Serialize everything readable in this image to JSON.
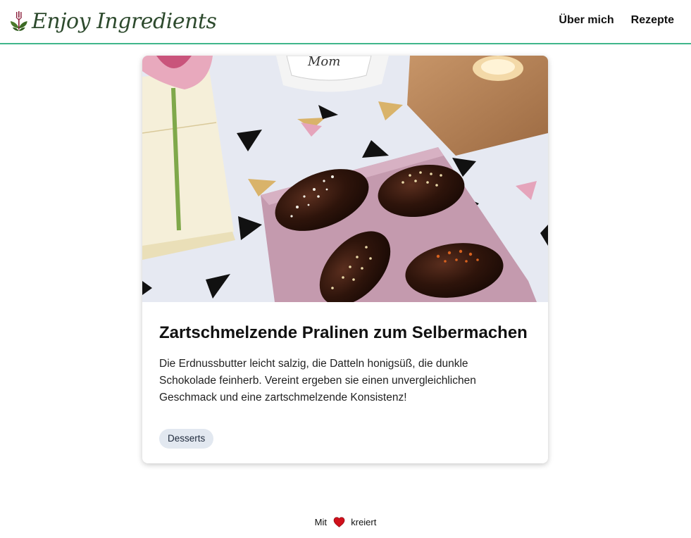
{
  "header": {
    "logo_text": "Enjoy Ingredients",
    "nav": [
      {
        "label": "Über mich"
      },
      {
        "label": "Rezepte"
      }
    ]
  },
  "card": {
    "title": "Zartschmelzende Pralinen zum Selbermachen",
    "description": "Die Erdnussbutter leicht salzig, die Datteln honigsüß, die dunkle Schokolade feinherb. Vereint ergeben sie einen unvergleichlichen Geschmack und eine zartschmelzende Konsistenz!",
    "tag": "Desserts"
  },
  "footer": {
    "prefix": "Mit",
    "suffix": "kreiert"
  },
  "colors": {
    "accent_line": "#3fb68b",
    "heart": "#d0101b",
    "logo_green": "#2d4a2d",
    "logo_fork": "#8a1e3a",
    "tag_bg": "#e2e8f0"
  },
  "icons": {
    "logo": "fork-leaf-icon",
    "footer": "heart-icon"
  }
}
